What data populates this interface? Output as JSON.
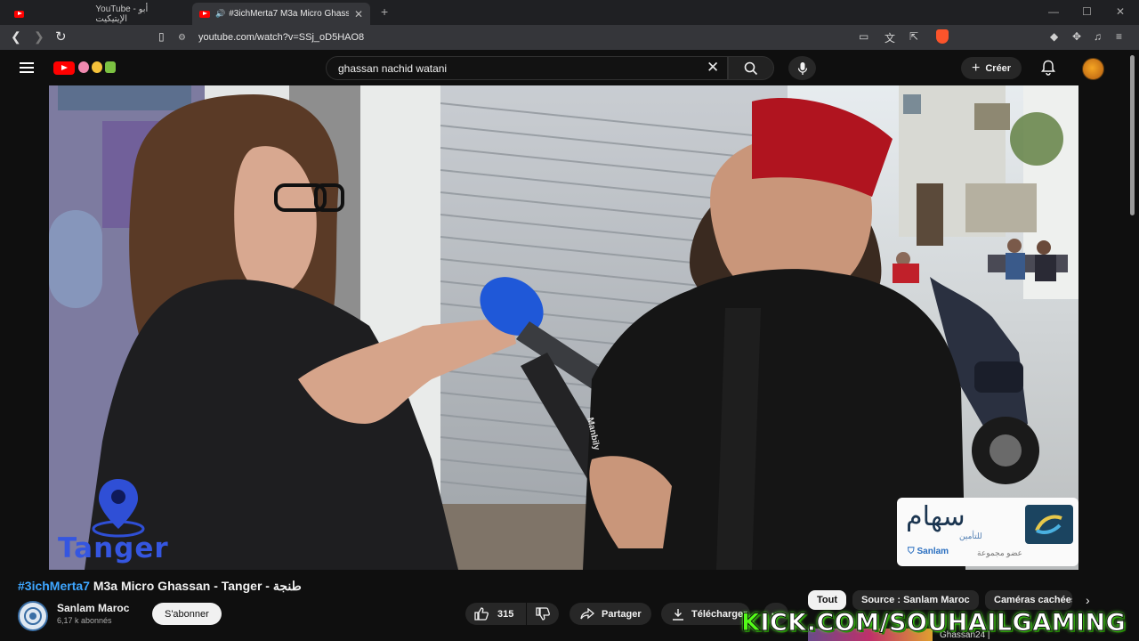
{
  "browser": {
    "tabs": [
      {
        "label": "YouTube - أبو الإيتيكيت",
        "active": false
      },
      {
        "label": "#3ichMerta7 M3a Micro Ghassan - Tanger",
        "active": true
      }
    ],
    "new_tab": "+",
    "url": "youtube.com/watch?v=SSj_oD5HAO8"
  },
  "youtube": {
    "search_query": "ghassan nachid watani",
    "create_label": "Créer"
  },
  "video": {
    "overlay_city": "Tanger",
    "mic_brand": "Manbily",
    "sponsor_arabic": "سهام",
    "sponsor_arabic_sub": "للتأمين",
    "sponsor_name": "Sanlam",
    "sponsor_tagline": "عضو مجموعة"
  },
  "details": {
    "title_hashtag": "#3ichMerta7",
    "title_rest": " M3a Micro Ghassan - Tanger - طنجة",
    "channel_name": "Sanlam Maroc",
    "subscribers": "6,17 k abonnés",
    "subscribe_label": "S'abonner",
    "like_count": "315",
    "share_label": "Partager",
    "download_label": "Télécharger"
  },
  "chips": [
    "Tout",
    "Source : Sanlam Maroc",
    "Caméras cachées"
  ],
  "watermark": {
    "k": "K",
    "rest": "ICK.COM/SOUHAILGAMING"
  },
  "up_next": {
    "channel": "Ghassan24 |"
  },
  "colors": {
    "youtube_red": "#ff0000",
    "link_blue": "#3ea6ff",
    "kick_green": "#53fc18",
    "fez_red": "#b0141f"
  }
}
